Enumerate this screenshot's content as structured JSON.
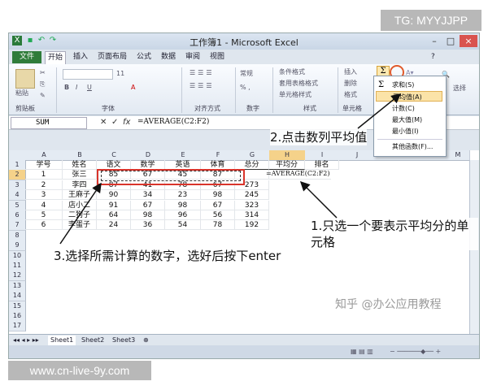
{
  "watermarks": {
    "top_right": "TG: MYYJJPP",
    "bottom_left": "www.cn-live-9y.com",
    "zhihu": "知乎 @办公应用教程"
  },
  "window": {
    "title": "工作簿1 - Microsoft Excel"
  },
  "ribbon": {
    "tabs": [
      "文件",
      "开始",
      "插入",
      "页面布局",
      "公式",
      "数据",
      "审阅",
      "视图"
    ],
    "groups": {
      "clipboard": "剪贴板",
      "font": "字体",
      "alignment": "对齐方式",
      "number": "数字",
      "styles": "样式",
      "cells": "单元格"
    },
    "paste_label": "粘贴",
    "font_size": "11",
    "number_format": "常规",
    "styles_items": [
      "条件格式",
      "套用表格格式",
      "单元格样式"
    ],
    "cells_items": [
      "插入",
      "删除",
      "格式"
    ],
    "select_label": "选择",
    "autosum_symbol": "Σ"
  },
  "formula_bar": {
    "name_box": "SUM",
    "formula": "=AVERAGE(C2:F2)"
  },
  "columns": [
    "A",
    "B",
    "C",
    "D",
    "E",
    "F",
    "G",
    "H",
    "I",
    "J",
    "K",
    "L",
    "M"
  ],
  "rows": [
    "1",
    "2",
    "3",
    "4",
    "5",
    "6",
    "7",
    "8",
    "9",
    "10",
    "11",
    "12",
    "13",
    "14",
    "15",
    "16",
    "17"
  ],
  "table": {
    "headers": [
      "学号",
      "姓名",
      "语文",
      "数学",
      "英语",
      "体育",
      "总分",
      "平均分",
      "排名"
    ],
    "data": [
      [
        "1",
        "张三",
        "85",
        "67",
        "45",
        "87",
        "",
        "=AVERAGE(C2:F2)"
      ],
      [
        "2",
        "李四",
        "87",
        "41",
        "78",
        "67",
        "273"
      ],
      [
        "3",
        "王麻子",
        "90",
        "34",
        "23",
        "98",
        "245"
      ],
      [
        "4",
        "店小二",
        "91",
        "67",
        "98",
        "67",
        "323"
      ],
      [
        "5",
        "二狗子",
        "64",
        "98",
        "96",
        "56",
        "314"
      ],
      [
        "6",
        "李蛋子",
        "24",
        "36",
        "54",
        "78",
        "192"
      ]
    ]
  },
  "sheets": [
    "Sheet1",
    "Sheet2",
    "Sheet3"
  ],
  "autosum_menu": {
    "items": [
      "求和(S)",
      "平均值(A)",
      "计数(C)",
      "最大值(M)",
      "最小值(I)",
      "其他函数(F)..."
    ],
    "highlighted": 1
  },
  "annotations": {
    "step1": "1.只选一个要表示平均分的单元格",
    "step2": "2.点击数列平均值",
    "step3": "3.选择所需计算的数字，选好后按下enter"
  },
  "colors": {
    "accent": "#2f7c3a",
    "highlight": "#d9342b",
    "selection": "#f5d28a"
  }
}
